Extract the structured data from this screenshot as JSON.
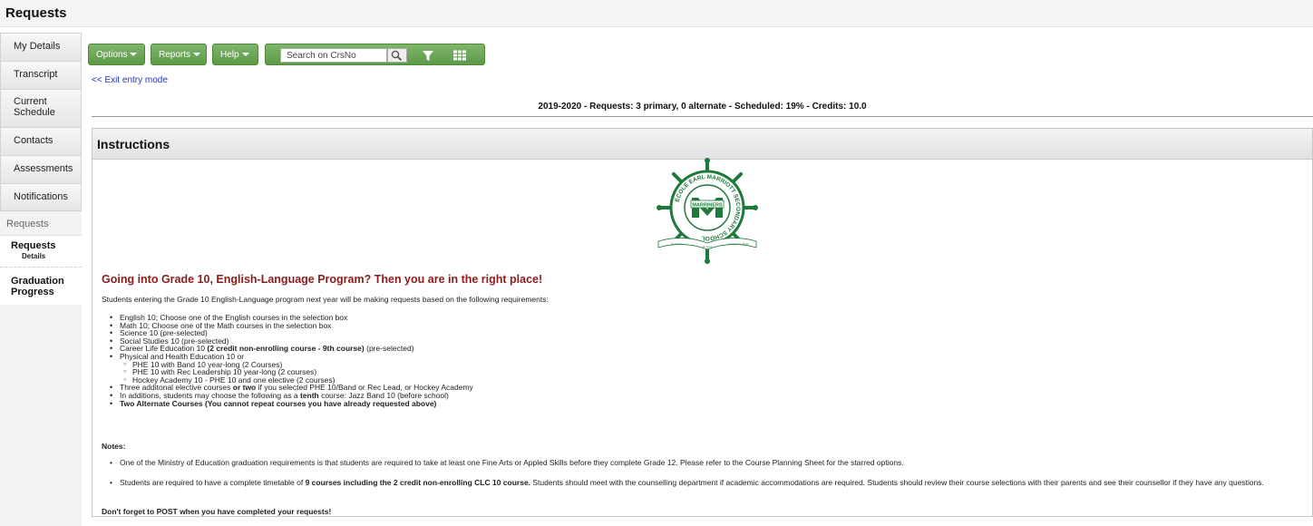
{
  "header": {
    "title": "Requests"
  },
  "sidebar": {
    "tabs": [
      {
        "label": "My Details"
      },
      {
        "label": "Transcript"
      },
      {
        "label": "Current Schedule"
      },
      {
        "label": "Contacts"
      },
      {
        "label": "Assessments"
      },
      {
        "label": "Notifications"
      }
    ],
    "section_label": "Requests",
    "subitems": [
      {
        "label": "Requests",
        "sublabel": "Details"
      },
      {
        "label": "Graduation Progress"
      }
    ]
  },
  "toolbar": {
    "options_label": "Options",
    "reports_label": "Reports",
    "help_label": "Help",
    "search_placeholder": "Search on CrsNo"
  },
  "exit_link": "<< Exit entry mode",
  "summary": "2019-2020 - Requests: 3 primary, 0 alternate - Scheduled: 19% - Credits: 10.0",
  "instructions": {
    "title": "Instructions",
    "logo": {
      "ring_text": "ÉCOLE EARL MARRIOTT SECONDARY SCHOOL",
      "center_text": "MARRINERS",
      "banner_left": "To Strive",
      "banner_center": "To Seek",
      "banner_right": "And Not to Yield"
    },
    "heading": "Going into Grade 10, English-Language Program? Then you are in the right place!",
    "intro": "Students entering the Grade 10 English-Language program next year will be making requests based on the following requirements:",
    "requirements": {
      "english": "English 10; Choose one of the English courses in the selection box",
      "math": "Math 10; Choose one of the Math courses in the selection box",
      "science": "Science 10 (pre-selected)",
      "social": "Social Studies 10 (pre-selected)",
      "career_a": "Career Life Education 10 ",
      "career_b": "(2 credit non-enrolling course - 9th course)",
      "career_c": " (pre-selected)",
      "phe": "Physical and Health Education 10 or",
      "phe_options": [
        "PHE 10 with Band 10 year-long (2 Courses)",
        "PHE 10 with Rec Leadership 10 year-long (2 courses)",
        "Hockey Academy 10 - PHE 10 and one elective (2 courses)"
      ],
      "elective_a": "Three additonal elective courses ",
      "elective_b": "or two",
      "elective_c": " if you selected PHE 10/Band or Rec Lead, or Hockey Academy",
      "additions_a": "In additions, students may choose the following as a ",
      "additions_b": "tenth",
      "additions_c": " course: Jazz Band 10 (before school)",
      "alternates": "Two Alternate Courses (You cannot repeat courses you have already requested above)"
    },
    "notes_label": "Notes:",
    "note1": "One of the Ministry of Education graduation requirements is that students are required to take at least one Fine Arts or Appled Skills before they complete Grade 12. Please refer to the Course Planning Sheet for the starred options.",
    "note2_a": "Students are required to have a complete timetable of ",
    "note2_b": "9 courses including the 2 credit non-enrolling CLC 10 course.",
    "note2_c": " Students should meet with the counselling department if academic accommodations are required. Students should review their course selections with their parents and see their counsellor if they have any questions.",
    "final": "Don't forget to POST when you have completed your requests!"
  },
  "colors": {
    "accent_green": "#5d9a47",
    "logo_green": "#1e7a3a",
    "heading_red": "#8c1c1c",
    "link_blue": "#2233bb"
  },
  "icons": [
    "search-icon",
    "filter-icon",
    "grid-view-icon"
  ]
}
